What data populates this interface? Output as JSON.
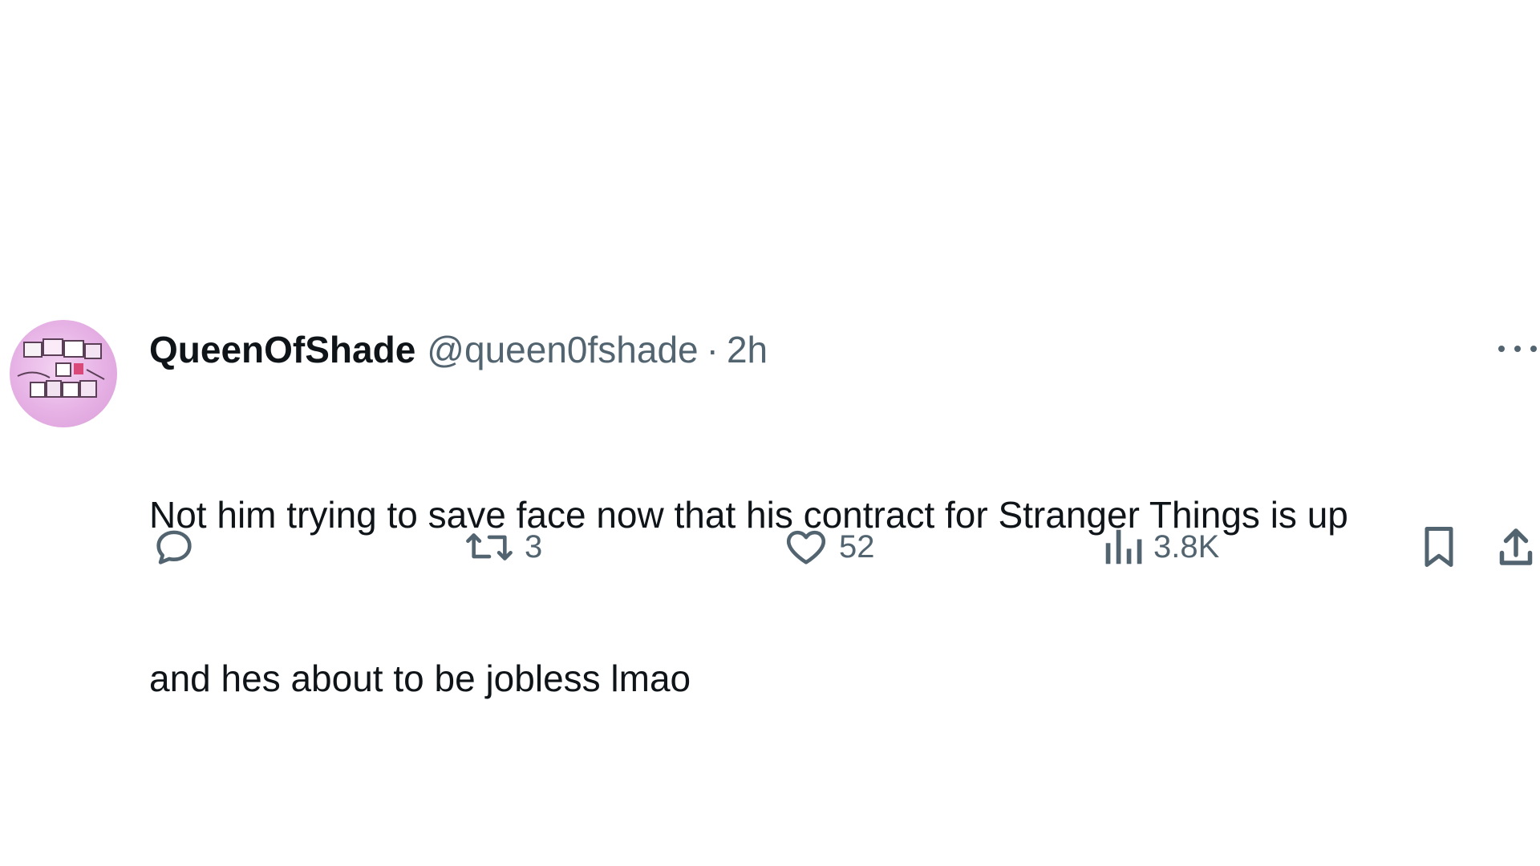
{
  "tweet": {
    "avatar_icon": "queenofshade-avatar-icon",
    "display_name": "QueenOfShade",
    "handle": "@queen0fshade",
    "separator": "·",
    "time": "2h",
    "more_icon": "more-horizontal-icon",
    "text_line_1": "Not him trying to save face now that his contract for Stranger Things is up",
    "text_line_2": "and hes about to be jobless lmao"
  },
  "actions": {
    "reply": {
      "icon": "reply-icon",
      "count": ""
    },
    "repost": {
      "icon": "repost-icon",
      "count": "3"
    },
    "like": {
      "icon": "heart-icon",
      "count": "52"
    },
    "views": {
      "icon": "views-chart-icon",
      "count": "3.8K"
    },
    "bookmark": {
      "icon": "bookmark-icon"
    },
    "share": {
      "icon": "share-icon"
    }
  },
  "colors": {
    "primary_text": "#0f1419",
    "secondary_text": "#536471",
    "avatar_background": "#e6b1e5"
  }
}
